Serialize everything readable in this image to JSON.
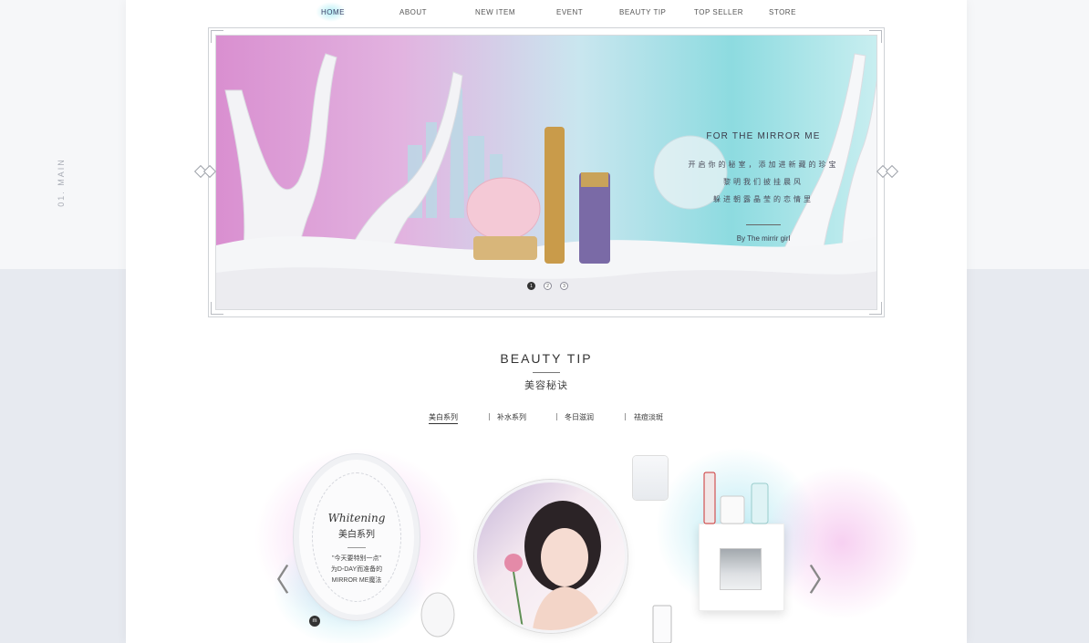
{
  "nav": {
    "items": [
      "HOME",
      "ABOUT",
      "NEW ITEM",
      "EVENT",
      "BEAUTY TIP",
      "TOP SELLER",
      "STORE"
    ],
    "active": "HOME"
  },
  "side_label": "01. MAIN",
  "hero": {
    "title": "FOR THE MIRROR ME",
    "lines": [
      "开启你的秘室，添加进新藏的珍宝",
      "黎明我们披挂晨风",
      "躲进朝露晶莹的恋情里"
    ],
    "byline": "By The mirrir girl",
    "slides": [
      "1",
      "2",
      "3"
    ],
    "active_slide": 1
  },
  "beauty_tip": {
    "title": "BEAUTY TIP",
    "subtitle": "美容秘诀",
    "tabs": [
      "美白系列",
      "补水系列",
      "冬日滋润",
      "祛痘淡斑"
    ],
    "active_tab": "美白系列"
  },
  "card": {
    "script_title": "Whitening",
    "cn_title": "美白系列",
    "lines": [
      "\"今天要特别一点\"",
      "为D-DAY而准备的",
      "MIRROR ME魔法"
    ],
    "logo_text": "m"
  },
  "arrows": {
    "left": "〈",
    "right": "〉"
  },
  "colors": {
    "accent_pink": "#e2a6dc",
    "accent_teal": "#8ddbe0",
    "text_dark": "#333333",
    "page_bg": "#e7eaf0"
  },
  "icons": [
    "diamond-ornament-icon",
    "chevron-left-icon",
    "chevron-right-icon",
    "logo-m-icon"
  ]
}
